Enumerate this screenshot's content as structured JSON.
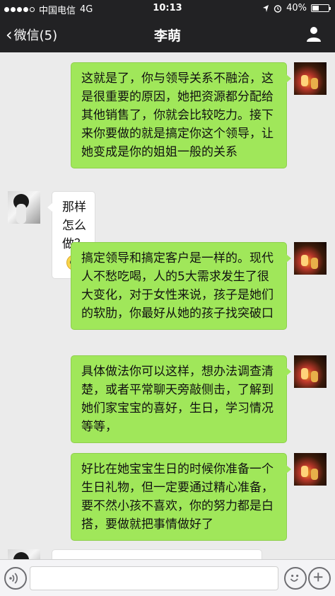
{
  "status": {
    "carrier": "中国电信",
    "network": "4G",
    "time": "10:13",
    "battery": "40%",
    "battery_level": 0.4
  },
  "nav": {
    "back_label": "微信(5)",
    "title": "李萌"
  },
  "messages": [
    {
      "side": "right",
      "text": "这就是了，你与领导关系不融洽，这是很重要的原因，她把资源都分配给其他销售了，你就会比较吃力。接下来你要做的就是搞定你这个领导，让她变成是你的姐姐一般的关系"
    },
    {
      "side": "left",
      "text": "那样怎么做？"
    },
    {
      "side": "right",
      "text": "搞定领导和搞定客户是一样的。现代人不愁吃喝，人的5大需求发生了很大变化，对于女性来说，孩子是她们的软肋，你最好从她的孩子找突破口"
    },
    {
      "side": "right",
      "text": "具体做法你可以这样，想办法调查清楚，或者平常聊天旁敲侧击，了解到她们家宝宝的喜好，生日，学习情况等等，"
    },
    {
      "side": "right",
      "text": "好比在她宝宝生日的时候你准备一个生日礼物，但一定要通过精心准备，要不然小孩不喜欢，你的努力都是白搭，要做就把事情做好了"
    }
  ],
  "colors": {
    "bar_bg": "#222224",
    "chat_bg": "#ebebeb",
    "bubble_green": "#a0e75a",
    "bubble_white": "#ffffff"
  }
}
